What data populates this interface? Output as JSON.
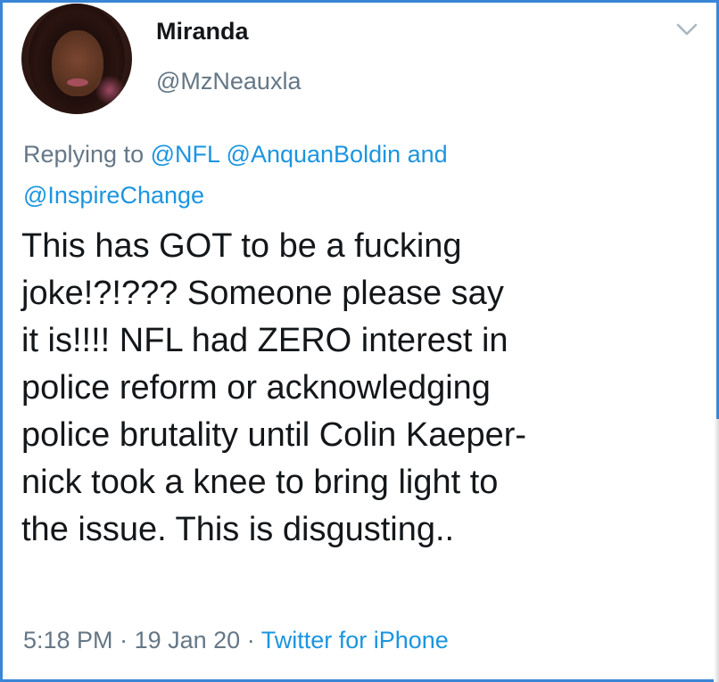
{
  "user": {
    "display_name": "Miranda",
    "handle": "@MzNeauxla"
  },
  "reply": {
    "prefix": "Replying to",
    "mentions": [
      "@NFL",
      "@AnquanBoldin",
      "@InspireChange"
    ],
    "conjunction": "and"
  },
  "tweet": {
    "lines": [
      "This has GOT to be a fucking",
      "joke!?!??? Someone please say",
      "it is!!!! NFL had ZERO interest in",
      "police reform or acknowledging",
      "police brutality until Colin Kaeper-",
      "nick took a knee to bring light to",
      "the issue. This is disgusting.."
    ]
  },
  "meta": {
    "time": "5:18 PM",
    "date": "19 Jan 20",
    "separator": "·",
    "source": "Twitter for iPhone"
  },
  "icons": {
    "menu": "chevron-down-icon",
    "avatar": "profile-avatar"
  },
  "colors": {
    "link": "#1b95e0",
    "secondary_text": "#657786",
    "primary_text": "#14171a",
    "frame": "#3a86d6"
  }
}
